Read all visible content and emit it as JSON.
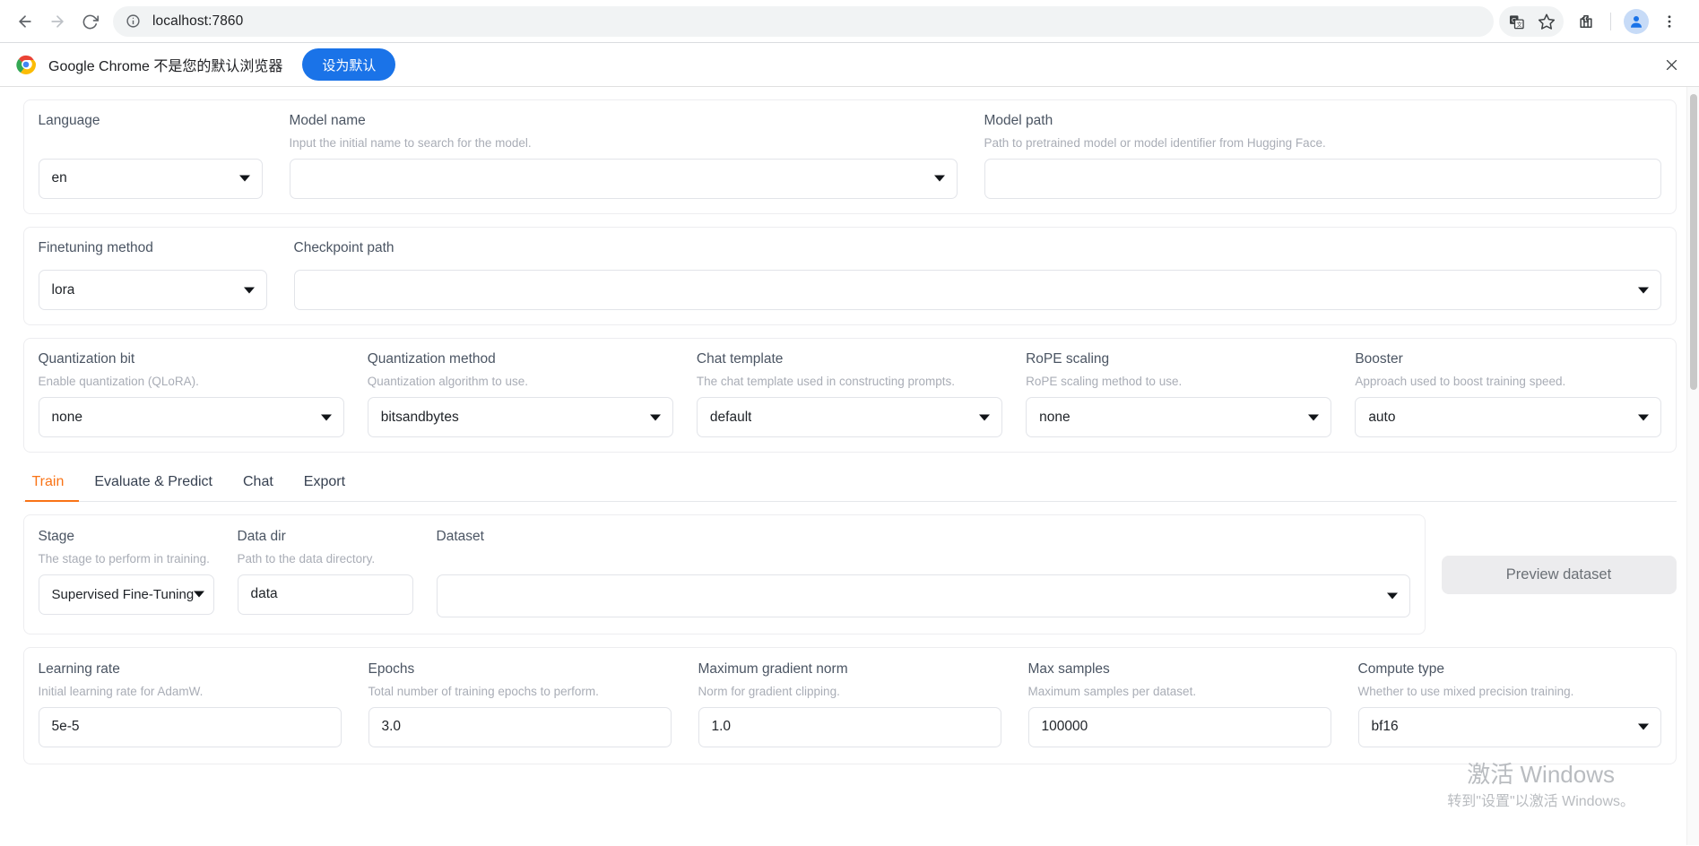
{
  "browser": {
    "url": "localhost:7860",
    "back_icon": "back-arrow-icon",
    "forward_icon": "forward-arrow-icon",
    "reload_icon": "reload-icon",
    "info_icon": "site-info-icon",
    "translate_icon": "translate-icon",
    "bookmark_icon": "bookmark-star-icon",
    "extensions_icon": "extensions-puzzle-icon",
    "profile_icon": "profile-avatar-icon",
    "menu_icon": "three-dot-menu-icon"
  },
  "infobar": {
    "message": "Google Chrome 不是您的默认浏览器",
    "button_label": "设为默认",
    "close_icon": "close-icon"
  },
  "top_config": {
    "language": {
      "label": "Language",
      "value": "en"
    },
    "model_name": {
      "label": "Model name",
      "help": "Input the initial name to search for the model.",
      "value": ""
    },
    "model_path": {
      "label": "Model path",
      "help": "Path to pretrained model or model identifier from Hugging Face.",
      "value": ""
    },
    "finetuning_method": {
      "label": "Finetuning method",
      "value": "lora"
    },
    "checkpoint_path": {
      "label": "Checkpoint path",
      "value": ""
    },
    "quantization_bit": {
      "label": "Quantization bit",
      "help": "Enable quantization (QLoRA).",
      "value": "none"
    },
    "quantization_method": {
      "label": "Quantization method",
      "help": "Quantization algorithm to use.",
      "value": "bitsandbytes"
    },
    "chat_template": {
      "label": "Chat template",
      "help": "The chat template used in constructing prompts.",
      "value": "default"
    },
    "rope_scaling": {
      "label": "RoPE scaling",
      "help": "RoPE scaling method to use.",
      "value": "none"
    },
    "booster": {
      "label": "Booster",
      "help": "Approach used to boost training speed.",
      "value": "auto"
    }
  },
  "tabs": [
    {
      "label": "Train",
      "active": true
    },
    {
      "label": "Evaluate & Predict",
      "active": false
    },
    {
      "label": "Chat",
      "active": false
    },
    {
      "label": "Export",
      "active": false
    }
  ],
  "train": {
    "stage": {
      "label": "Stage",
      "help": "The stage to perform in training.",
      "value": "Supervised Fine-Tuning"
    },
    "data_dir": {
      "label": "Data dir",
      "help": "Path to the data directory.",
      "value": "data"
    },
    "dataset": {
      "label": "Dataset",
      "value": ""
    },
    "preview_dataset_button": "Preview dataset",
    "learning_rate": {
      "label": "Learning rate",
      "help": "Initial learning rate for AdamW.",
      "value": "5e-5"
    },
    "epochs": {
      "label": "Epochs",
      "help": "Total number of training epochs to perform.",
      "value": "3.0"
    },
    "max_grad_norm": {
      "label": "Maximum gradient norm",
      "help": "Norm for gradient clipping.",
      "value": "1.0"
    },
    "max_samples": {
      "label": "Max samples",
      "help": "Maximum samples per dataset.",
      "value": "100000"
    },
    "compute_type": {
      "label": "Compute type",
      "help": "Whether to use mixed precision training.",
      "value": "bf16"
    }
  },
  "watermark": {
    "title": "激活 Windows",
    "subtitle": "转到\"设置\"以激活 Windows。"
  }
}
